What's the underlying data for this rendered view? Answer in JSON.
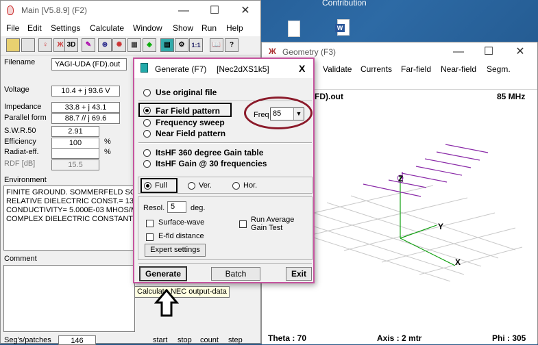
{
  "desktop": {
    "label": "Contribution"
  },
  "main_window": {
    "title": "Main [V5.8.9]  (F2)",
    "menu": [
      "File",
      "Edit",
      "Settings",
      "Calculate",
      "Window",
      "Show",
      "Run",
      "Help"
    ],
    "toolbar_labels": {
      "view3d": "3D",
      "ratio": "1:1"
    },
    "fields": {
      "filename_label": "Filename",
      "filename": "YAGI-UDA (FD).out",
      "voltage_label": "Voltage",
      "voltage": "10.4 + j 93.6 V",
      "impedance_label": "Impedance",
      "impedance": "33.8 + j 43.1",
      "parallel_label": "Parallel form",
      "parallel": "88.7 // j 69.6",
      "swr_label": "S.W.R.50",
      "swr": "2.91",
      "efficiency_label": "Efficiency",
      "efficiency": "100",
      "efficiency_unit": "%",
      "radiat_label": "Radiat-eff.",
      "radiat_unit": "%",
      "rdf_label": "RDF [dB]",
      "rdf": "15.5"
    },
    "environment_label": "Environment",
    "environment_lines": [
      "FINITE GROUND.  SOMMERFELD SO",
      "RELATIVE DIELECTRIC CONST.= 13.",
      "CONDUCTIVITY= 5.000E-03 MHOS/M",
      "COMPLEX DIELECTRIC CONSTANT="
    ],
    "comment_label": "Comment",
    "segs_label": "Seg's/patches",
    "segs_value": "146",
    "bottom_labels": [
      "start",
      "stop",
      "count",
      "step"
    ]
  },
  "generate_dialog": {
    "title": "Generate (F7)",
    "engine": "[Nec2dXS1k5]",
    "close": "X",
    "options": [
      {
        "label": "Use original file",
        "selected": false
      },
      {
        "label": "Far Field pattern",
        "selected": true
      },
      {
        "label": "Frequency sweep",
        "selected": false
      },
      {
        "label": "Near Field pattern",
        "selected": false
      },
      {
        "label": "ItsHF 360 degree Gain table",
        "selected": false
      },
      {
        "label": "ItsHF Gain @ 30 frequencies",
        "selected": false
      }
    ],
    "freq_label": "Freq :",
    "freq_value": "85",
    "pattern_types": [
      {
        "label": "Full",
        "selected": true
      },
      {
        "label": "Ver.",
        "selected": false
      },
      {
        "label": "Hor.",
        "selected": false
      }
    ],
    "resol_label": "Resol.",
    "resol_value": "5",
    "resol_unit": "deg.",
    "checkboxes": [
      {
        "label": "Surface-wave",
        "checked": false
      },
      {
        "label": "E-fld distance",
        "checked": false
      },
      {
        "label": "Run Average",
        "label2": "Gain Test",
        "checked": false
      }
    ],
    "expert_button": "Expert settings",
    "generate_button": "Generate",
    "batch_button": "Batch",
    "exit_button": "Exit",
    "tooltip": "Calculate NEC output-data"
  },
  "geometry_window": {
    "title": "Geometry  (F3)",
    "menu": [
      "Validate",
      "Currents",
      "Far-field",
      "Near-field",
      "Segm."
    ],
    "file_label": "FD).out",
    "freq_label": "85 MHz",
    "axis_labels": {
      "z": "Z",
      "y": "Y",
      "x": "X"
    },
    "theta": "Theta : 70",
    "axis": "Axis : 2 mtr",
    "phi": "Phi : 305"
  },
  "colors": {
    "highlight_red": "#8b1a2a",
    "dialog_border": "#c5539e",
    "antenna": "#8a2aa8",
    "axis_green": "#0fa00f",
    "grid": "#c9c9c9"
  }
}
